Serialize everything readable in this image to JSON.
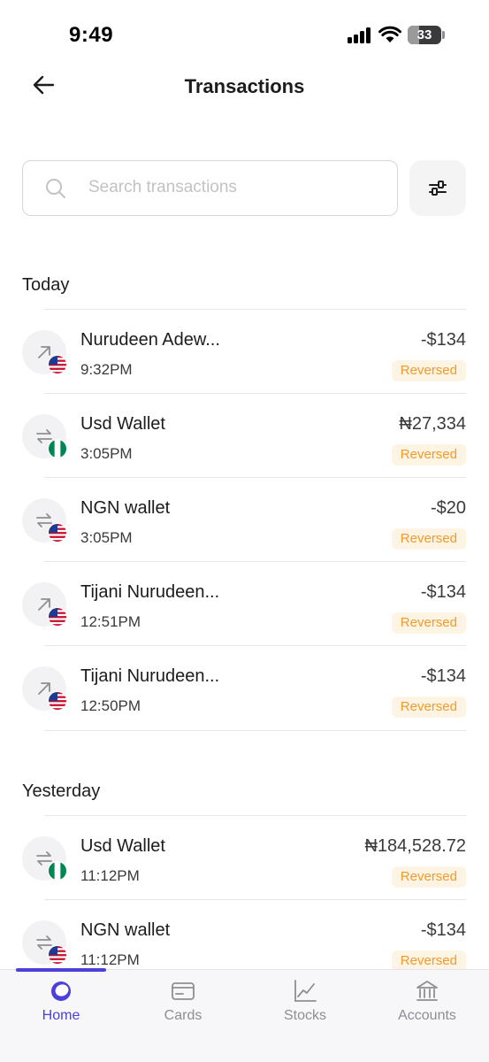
{
  "status_bar": {
    "time": "9:49",
    "battery": "33"
  },
  "header": {
    "title": "Transactions",
    "back_icon": "arrow-left-icon"
  },
  "search": {
    "placeholder": "Search transactions",
    "value": "",
    "filter_icon": "filter-sliders-icon"
  },
  "sections": [
    {
      "title": "Today",
      "transactions": [
        {
          "name": "Nurudeen Adew...",
          "time": "9:32PM",
          "amount": "-$134",
          "status": "Reversed",
          "icon": "arrow-up-right-icon",
          "flag": "us-flag-icon"
        },
        {
          "name": "Usd Wallet",
          "time": "3:05PM",
          "amount": "₦27,334",
          "status": "Reversed",
          "icon": "swap-arrows-icon",
          "flag": "ng-flag-icon"
        },
        {
          "name": "NGN wallet",
          "time": "3:05PM",
          "amount": "-$20",
          "status": "Reversed",
          "icon": "swap-arrows-icon",
          "flag": "us-flag-icon"
        },
        {
          "name": "Tijani Nurudeen...",
          "time": "12:51PM",
          "amount": "-$134",
          "status": "Reversed",
          "icon": "arrow-up-right-icon",
          "flag": "us-flag-icon"
        },
        {
          "name": "Tijani Nurudeen...",
          "time": "12:50PM",
          "amount": "-$134",
          "status": "Reversed",
          "icon": "arrow-up-right-icon",
          "flag": "us-flag-icon"
        }
      ]
    },
    {
      "title": "Yesterday",
      "transactions": [
        {
          "name": "Usd Wallet",
          "time": "11:12PM",
          "amount": "₦184,528.72",
          "status": "Reversed",
          "icon": "swap-arrows-icon",
          "flag": "ng-flag-icon"
        },
        {
          "name": "NGN wallet",
          "time": "11:12PM",
          "amount": "-$134",
          "status": "Reversed",
          "icon": "swap-arrows-icon",
          "flag": "us-flag-icon"
        }
      ]
    }
  ],
  "tabs": [
    {
      "label": "Home",
      "icon": "home-logo-icon",
      "active": true
    },
    {
      "label": "Cards",
      "icon": "card-icon",
      "active": false
    },
    {
      "label": "Stocks",
      "icon": "chart-line-icon",
      "active": false
    },
    {
      "label": "Accounts",
      "icon": "bank-icon",
      "active": false
    }
  ],
  "colors": {
    "accent": "#4b40d9",
    "status_text": "#f39a2b",
    "status_bg": "#fef4e4"
  }
}
